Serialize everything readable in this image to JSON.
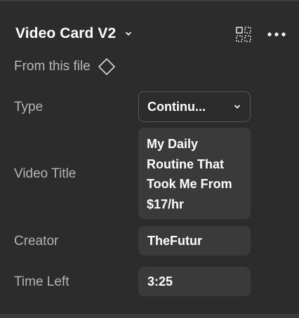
{
  "panel": {
    "title": "Video Card V2",
    "source_label": "From this file"
  },
  "properties": [
    {
      "label": "Type",
      "value": "Continu...",
      "kind": "select"
    },
    {
      "label": "Video Title",
      "value": "My Daily Routine That Took Me From $17/hr",
      "kind": "text"
    },
    {
      "label": "Creator",
      "value": "TheFutur",
      "kind": "text"
    },
    {
      "label": "Time Left",
      "value": "3:25",
      "kind": "text"
    }
  ],
  "icons": {
    "title_chevron": "chevron-down-icon",
    "instance_swap": "component-grid-icon",
    "more": "more-horizontal-icon",
    "source": "diamond-component-icon",
    "select_chevron": "chevron-down-icon"
  },
  "colors": {
    "panel_bg": "#2c2c2c",
    "field_bg": "#3a3a3a",
    "label_text": "#b3b3b3",
    "value_text": "#ffffff"
  }
}
